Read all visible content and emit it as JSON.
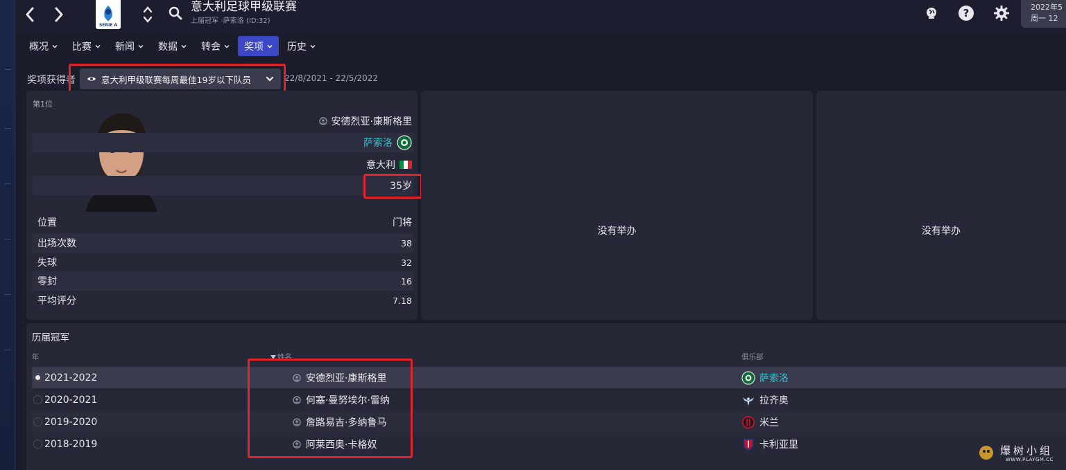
{
  "header": {
    "title": "意大利足球甲级联赛",
    "subtitle": "上届冠军 -萨索洛 (ID:32)",
    "logo_text": "SERIE A",
    "date_line1": "2022年5",
    "date_line2": "周一 12"
  },
  "tabs": [
    {
      "label": "概况",
      "active": false
    },
    {
      "label": "比赛",
      "active": false
    },
    {
      "label": "新闻",
      "active": false
    },
    {
      "label": "数据",
      "active": false
    },
    {
      "label": "转会",
      "active": false
    },
    {
      "label": "奖项",
      "active": true
    },
    {
      "label": "历史",
      "active": false
    }
  ],
  "award": {
    "section_label": "奖项获得者",
    "selected_award": "意大利甲级联赛每周最佳19岁以下队员",
    "date_range": "22/8/2021 - 22/5/2022"
  },
  "winner": {
    "rank": "第1位",
    "name": "安德烈亚·康斯格里",
    "club": "萨索洛",
    "nation": "意大利",
    "age": "35岁",
    "stats": [
      {
        "label": "位置",
        "value": "门将"
      },
      {
        "label": "出场次数",
        "value": "38"
      },
      {
        "label": "失球",
        "value": "32"
      },
      {
        "label": "零封",
        "value": "16"
      },
      {
        "label": "平均评分",
        "value": "7.18"
      }
    ]
  },
  "empty_cards": [
    "没有举办",
    "没有举办"
  ],
  "history": {
    "title": "历届冠军",
    "col_year": "年",
    "col_name": "姓名",
    "col_club": "俱乐部",
    "rows": [
      {
        "year": "2021-2022",
        "name": "安德烈亚·康斯格里",
        "club": "萨索洛",
        "club_icon": "sassuolo-crest",
        "selected": true
      },
      {
        "year": "2020-2021",
        "name": "何塞·曼努埃尔·雷纳",
        "club": "拉齐奥",
        "club_icon": "lazio-eagle",
        "selected": false
      },
      {
        "year": "2019-2020",
        "name": "詹路易吉·多纳鲁马",
        "club": "米兰",
        "club_icon": "milan-crest",
        "selected": false
      },
      {
        "year": "2018-2019",
        "name": "阿莱西奥·卡格奴",
        "club": "卡利亚里",
        "club_icon": "cagliari-crest",
        "selected": false
      }
    ]
  },
  "watermark": {
    "text": "爆树小组",
    "url": "WWW.PLAYGM.CC"
  },
  "colors": {
    "accent_tab": "#3b47c4",
    "club_link": "#35c0cf",
    "highlight": "#e0242a",
    "background": "#1b1c2c",
    "card": "#262737"
  }
}
